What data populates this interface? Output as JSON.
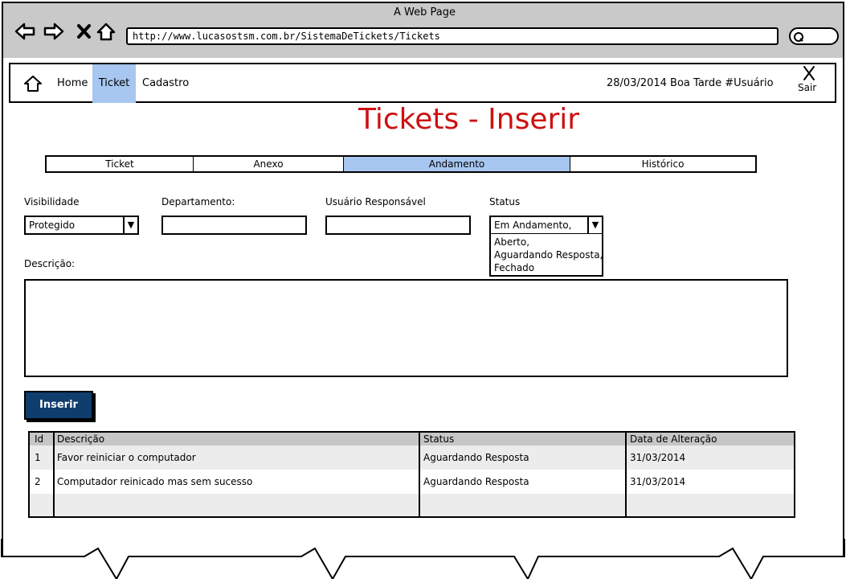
{
  "browser": {
    "title": "A Web Page",
    "url": "http://www.lucasostsm.com.br/SistemaDeTickets/Tickets"
  },
  "nav": {
    "items": [
      {
        "label": "Home"
      },
      {
        "label": "Ticket",
        "active": true
      },
      {
        "label": "Cadastro"
      }
    ],
    "date_greeting": "28/03/2014 Boa Tarde #Usuário",
    "logout_label": "Sair"
  },
  "page": {
    "title": "Tickets - Inserir"
  },
  "tabs": [
    {
      "label": "Ticket"
    },
    {
      "label": "Anexo"
    },
    {
      "label": "Andamento",
      "active": true
    },
    {
      "label": "Histórico"
    }
  ],
  "form": {
    "visibilidade": {
      "label": "Visibilidade",
      "value": "Protegido"
    },
    "departamento": {
      "label": "Departamento:",
      "value": ""
    },
    "usuario": {
      "label": "Usuário Responsável",
      "value": ""
    },
    "status": {
      "label": "Status",
      "value": "Em Andamento,",
      "options": [
        "Aberto,",
        "Aguardando Resposta,",
        "Fechado"
      ]
    },
    "descricao": {
      "label": "Descrição:"
    },
    "submit_label": "Inserir"
  },
  "table": {
    "columns": [
      "Id",
      "Descrição",
      "Status",
      "Data de Alteração"
    ],
    "rows": [
      [
        "1",
        "Favor reiniciar o computador",
        "Aguardando Resposta",
        "31/03/2014"
      ],
      [
        "2",
        "Computador reinicado mas sem sucesso",
        "Aguardando Resposta",
        "31/03/2014"
      ]
    ]
  },
  "colors": {
    "title": "#cc1111",
    "active_tab": "#a7c6f0",
    "button": "#0f3e6e",
    "chrome": "#c9c9c9",
    "table_header": "#c6c6c6"
  }
}
